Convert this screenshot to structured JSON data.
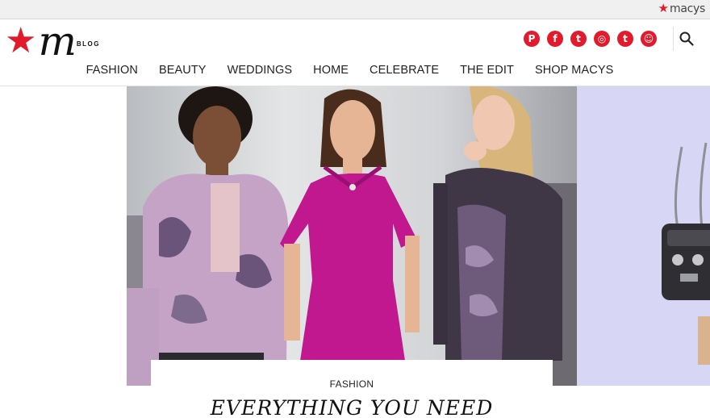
{
  "topbar": {
    "logo_text": "macys"
  },
  "brand": {
    "logo_letter": "m",
    "logo_tag": "BLOG"
  },
  "social": {
    "color": "#e21a2c",
    "items": [
      {
        "name": "pinterest-icon",
        "glyph": "P"
      },
      {
        "name": "facebook-icon",
        "glyph": "f"
      },
      {
        "name": "twitter-icon",
        "glyph": "t"
      },
      {
        "name": "instagram-icon",
        "glyph": "◎"
      },
      {
        "name": "tumblr-icon",
        "glyph": "t"
      },
      {
        "name": "snapchat-icon",
        "glyph": "☺"
      }
    ]
  },
  "nav": {
    "items": [
      "FASHION",
      "BEAUTY",
      "WEDDINGS",
      "HOME",
      "CELEBRATE",
      "THE EDIT",
      "SHOP MACYS"
    ]
  },
  "hero": {
    "category": "FASHION",
    "title": "EVERYTHING YOU NEED"
  },
  "colors": {
    "brand_red": "#e21a2c",
    "side_panel": "#d7d6f4",
    "dress_magenta": "#c1188f"
  }
}
